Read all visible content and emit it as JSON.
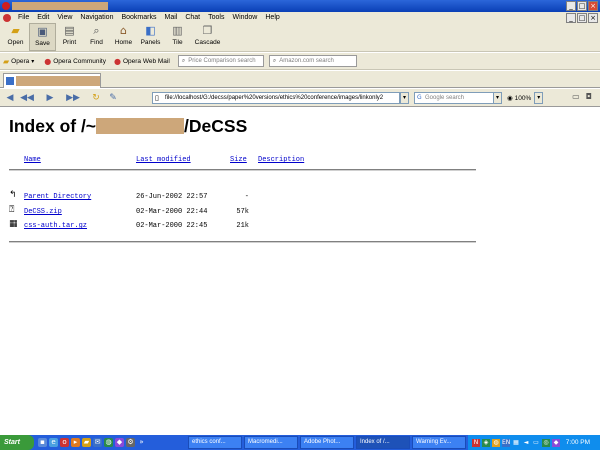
{
  "menu": [
    "File",
    "Edit",
    "View",
    "Navigation",
    "Bookmarks",
    "Mail",
    "Chat",
    "Tools",
    "Window",
    "Help"
  ],
  "toolbar": [
    {
      "label": "Open",
      "icon": "folder-open-icon"
    },
    {
      "label": "Save",
      "icon": "save-icon"
    },
    {
      "label": "Print",
      "icon": "printer-icon"
    },
    {
      "label": "Find",
      "icon": "magnifier-icon"
    },
    {
      "label": "Home",
      "icon": "home-icon"
    },
    {
      "label": "Panels",
      "icon": "panels-icon"
    },
    {
      "label": "Tile",
      "icon": "tile-icon"
    },
    {
      "label": "Cascade",
      "icon": "cascade-icon"
    }
  ],
  "personal_bar": {
    "opera": "Opera",
    "community": "Opera Community",
    "webmail": "Opera Web Mail",
    "price_search_placeholder": "Price Comparison search",
    "amazon_search_placeholder": "Amazon.com search"
  },
  "address": {
    "url": "file://localhost/G:/decss/paper%20versions/ethics%20conference/images/linkonly2",
    "search_placeholder": "Google search",
    "zoom": "100%"
  },
  "page": {
    "title_prefix": "Index of /~",
    "title_suffix": "/DeCSS",
    "columns": {
      "name": "Name",
      "modified": "Last modified",
      "size": "Size",
      "description": "Description"
    },
    "rows": [
      {
        "name": "Parent Directory",
        "modified": "26-Jun-2002 22:57",
        "size": "-",
        "icon": "back-arrow-icon"
      },
      {
        "name": "DeCSS.zip",
        "modified": "02-Mar-2000 22:44",
        "size": "57k",
        "icon": "unknown-file-icon"
      },
      {
        "name": "css-auth.tar.gz",
        "modified": "02-Mar-2000 22:45",
        "size": "21k",
        "icon": "archive-file-icon"
      }
    ]
  },
  "taskbar": {
    "start": "Start",
    "tasks": [
      "ethics conf...",
      "Macromedi...",
      "Adobe Phot...",
      "Index of /...",
      "Warning Ev..."
    ],
    "clock": "7:00 PM"
  }
}
